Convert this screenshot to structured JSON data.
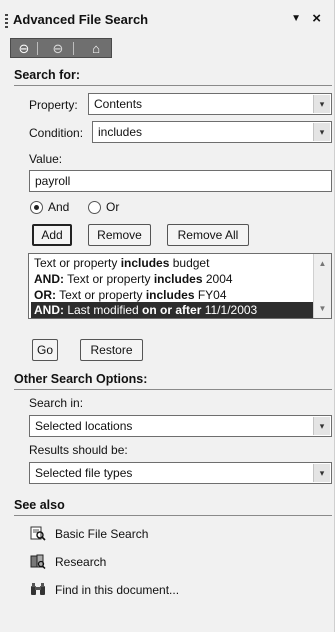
{
  "pane": {
    "title": "Advanced File Search",
    "dropdown_icon": "▼",
    "close_icon": "×"
  },
  "nav": {
    "back_icon": "⊖",
    "forward_icon": "⊖",
    "home_icon": "⌂"
  },
  "search_for": {
    "header": "Search for:",
    "property_label": "Property:",
    "property_value": "Contents",
    "condition_label": "Condition:",
    "condition_value": "includes",
    "value_label": "Value:",
    "value_text": "payroll",
    "and_label": "And",
    "or_label": "Or",
    "and_selected": true,
    "add_label": "Add",
    "remove_label": "Remove",
    "remove_all_label": "Remove All",
    "criteria": [
      {
        "prefix": "",
        "pre": "Text or property ",
        "op": "includes",
        "post": " budget",
        "selected": false
      },
      {
        "prefix": "AND:",
        "pre": " Text or property ",
        "op": "includes",
        "post": " 2004",
        "selected": false
      },
      {
        "prefix": "OR:",
        "pre": "  Text or property ",
        "op": "includes",
        "post": " FY04",
        "selected": false
      },
      {
        "prefix": "AND:",
        "pre": " Last modified ",
        "op": "on or after",
        "post": " 11/1/2003",
        "selected": true
      }
    ],
    "go_label": "Go",
    "restore_label": "Restore"
  },
  "other_options": {
    "header": "Other Search Options:",
    "search_in_label": "Search in:",
    "search_in_value": "Selected locations",
    "results_label": "Results should be:",
    "results_value": "Selected file types"
  },
  "see_also": {
    "header": "See also",
    "links": [
      {
        "label": "Basic File Search",
        "icon": "basic-file-search-icon"
      },
      {
        "label": "Research",
        "icon": "research-icon"
      },
      {
        "label": "Find in this document...",
        "icon": "binoculars-icon"
      }
    ]
  },
  "dropdown_arrow": "▾"
}
